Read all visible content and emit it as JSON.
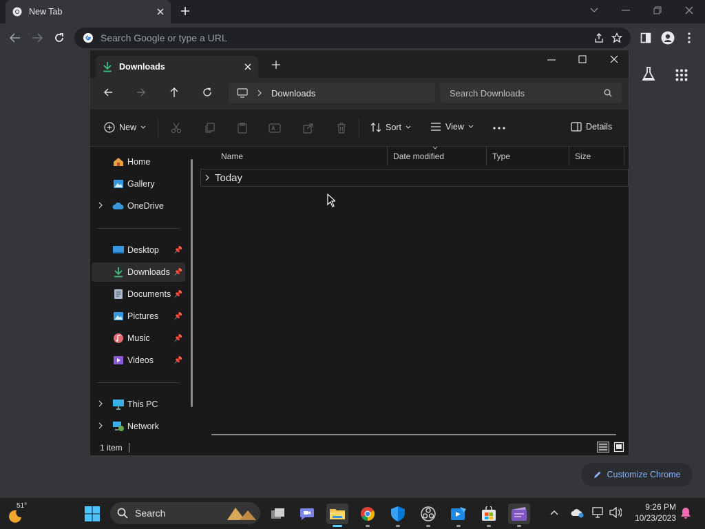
{
  "chrome": {
    "tab_title": "New Tab",
    "omnibox_placeholder": "Search Google or type a URL",
    "customize_label": "Customize Chrome"
  },
  "explorer": {
    "tab_title": "Downloads",
    "breadcrumb": "Downloads",
    "search_placeholder": "Search Downloads",
    "toolbar": {
      "new_label": "New",
      "sort_label": "Sort",
      "view_label": "View",
      "details_label": "Details"
    },
    "sidebar": [
      {
        "label": "Home",
        "icon": "home-icon"
      },
      {
        "label": "Gallery",
        "icon": "gallery-icon"
      },
      {
        "label": "OneDrive",
        "icon": "onedrive-icon"
      },
      {
        "label": "Desktop",
        "icon": "desktop-icon"
      },
      {
        "label": "Downloads",
        "icon": "download-icon"
      },
      {
        "label": "Documents",
        "icon": "documents-icon"
      },
      {
        "label": "Pictures",
        "icon": "pictures-icon"
      },
      {
        "label": "Music",
        "icon": "music-icon"
      },
      {
        "label": "Videos",
        "icon": "videos-icon"
      },
      {
        "label": "This PC",
        "icon": "this-pc-icon"
      },
      {
        "label": "Network",
        "icon": "network-icon"
      }
    ],
    "columns": [
      "Name",
      "Date modified",
      "Type",
      "Size"
    ],
    "group_label": "Today",
    "status_text": "1 item"
  },
  "taskbar": {
    "weather_temp": "51°",
    "search_label": "Search",
    "time": "9:26 PM",
    "date": "10/23/2023"
  },
  "colors": {
    "accent": "#60cdff",
    "download_green": "#3fbf7f",
    "chrome_link": "#8ab4f8"
  }
}
